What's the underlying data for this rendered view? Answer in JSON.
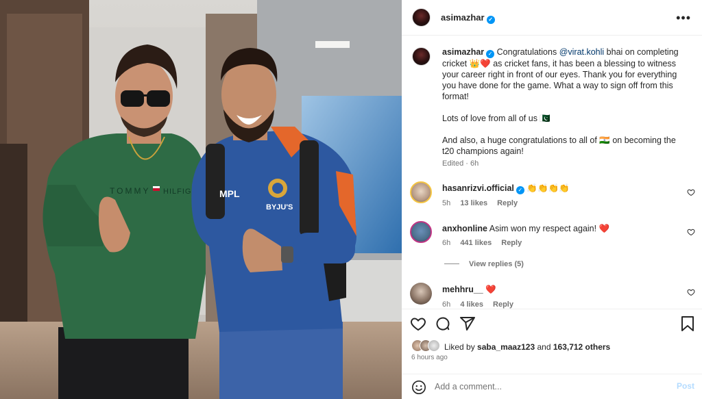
{
  "post": {
    "owner": "asimazhar",
    "photo_text": {
      "shirt_left": "TOMMY",
      "shirt_right": "HILFIGER",
      "sponsor_1": "MPL",
      "sponsor_2": "BYJU'S"
    }
  },
  "header": {
    "username": "asimazhar",
    "verified": true,
    "more_icon": "more-horizontal-icon"
  },
  "caption": {
    "username": "asimazhar",
    "parts": {
      "p1_a": "Congratulations",
      "p1_mention": "@virat.kohli",
      "p1_b": "bhai on completing cricket 👑❤️ as cricket fans, it has been a blessing to witness your career right in front of our eyes. Thank you for everything you have done for the game. What a way to sign off from this format!",
      "p2": "Lots of love from all of us 🇵🇰",
      "p3": "And also, a huge congratulations to all of 🇮🇳 on becoming the t20 champions again!"
    },
    "edited": "Edited · 6h"
  },
  "comments": [
    {
      "username": "hasanrizvi.official",
      "verified": true,
      "text": "👏👏👏👏",
      "time": "5h",
      "likes": "13 likes",
      "reply": "Reply"
    },
    {
      "username": "anxhonline",
      "verified": false,
      "text": "Asim won my respect again! ❤️",
      "time": "6h",
      "likes": "441 likes",
      "reply": "Reply",
      "view_replies": "View replies (5)"
    },
    {
      "username": "mehhru__",
      "verified": false,
      "text": "❤️",
      "time": "6h",
      "likes": "4 likes",
      "reply": "Reply"
    }
  ],
  "actions": {
    "icons": [
      "heart-icon",
      "comment-icon",
      "share-icon",
      "bookmark-icon"
    ],
    "liked_by_prefix": "Liked by",
    "liked_by_user": "saba_maaz123",
    "liked_by_mid": "and",
    "liked_by_count": "163,712 others",
    "time_ago": "6 hours ago"
  },
  "add_comment": {
    "placeholder": "Add a comment...",
    "post_label": "Post",
    "emoji_icon": "emoji-icon"
  },
  "colors": {
    "accent": "#0095f6",
    "heart": "#ed4956",
    "post_disabled": "#b3dbff",
    "muted": "#737373"
  }
}
